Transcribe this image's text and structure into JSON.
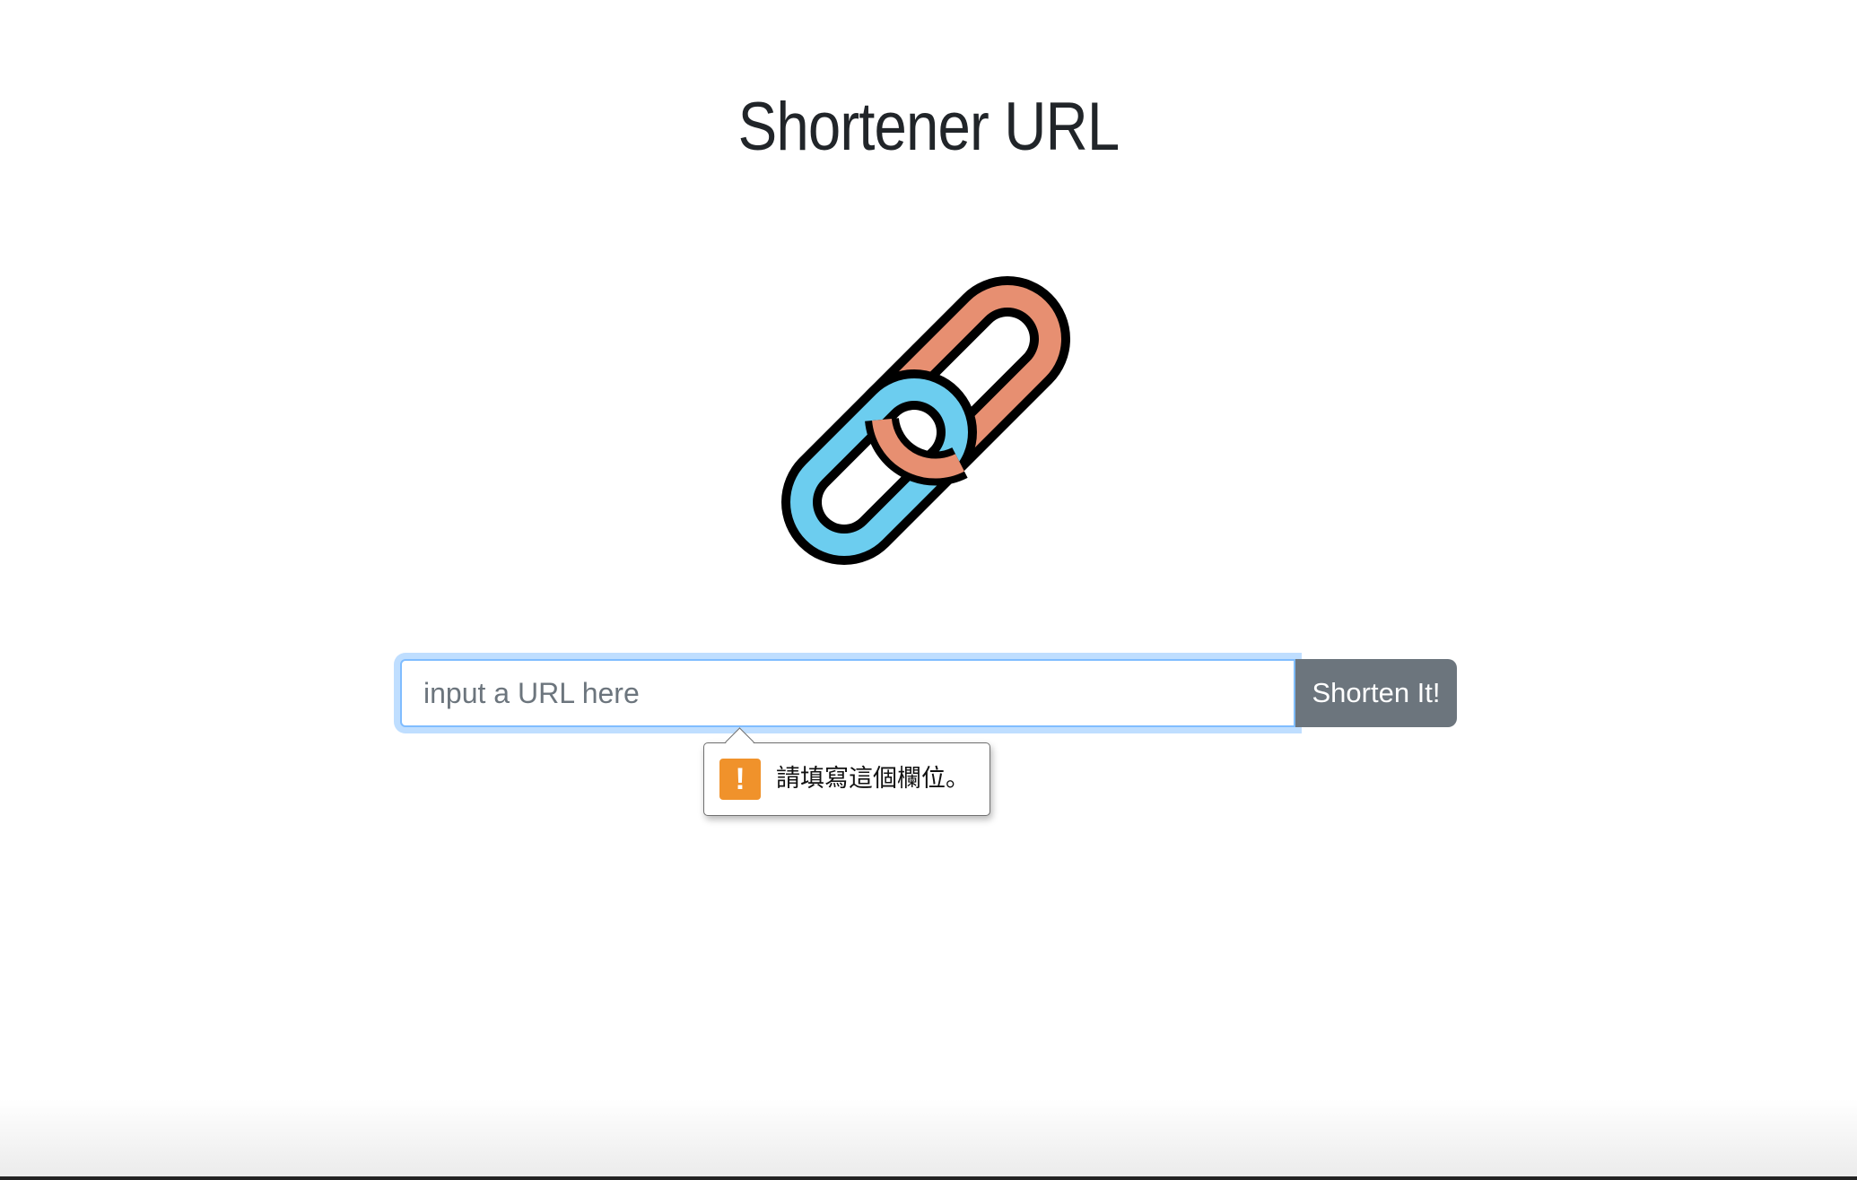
{
  "page": {
    "title": "Shortener URL"
  },
  "logo": {
    "icon": "chain-link-icon",
    "colors": {
      "link_orange": "#e78f71",
      "link_blue": "#6ccdef",
      "outline": "#000000"
    }
  },
  "form": {
    "input_placeholder": "input a URL here",
    "input_value": "",
    "submit_label": "Shorten It!"
  },
  "validation": {
    "icon": "warning-icon",
    "icon_symbol": "!",
    "message": "請填寫這個欄位。"
  },
  "colors": {
    "button_bg": "#6c757d",
    "focus_ring": "#80bdff",
    "warning": "#f0922b",
    "text": "#212529"
  }
}
